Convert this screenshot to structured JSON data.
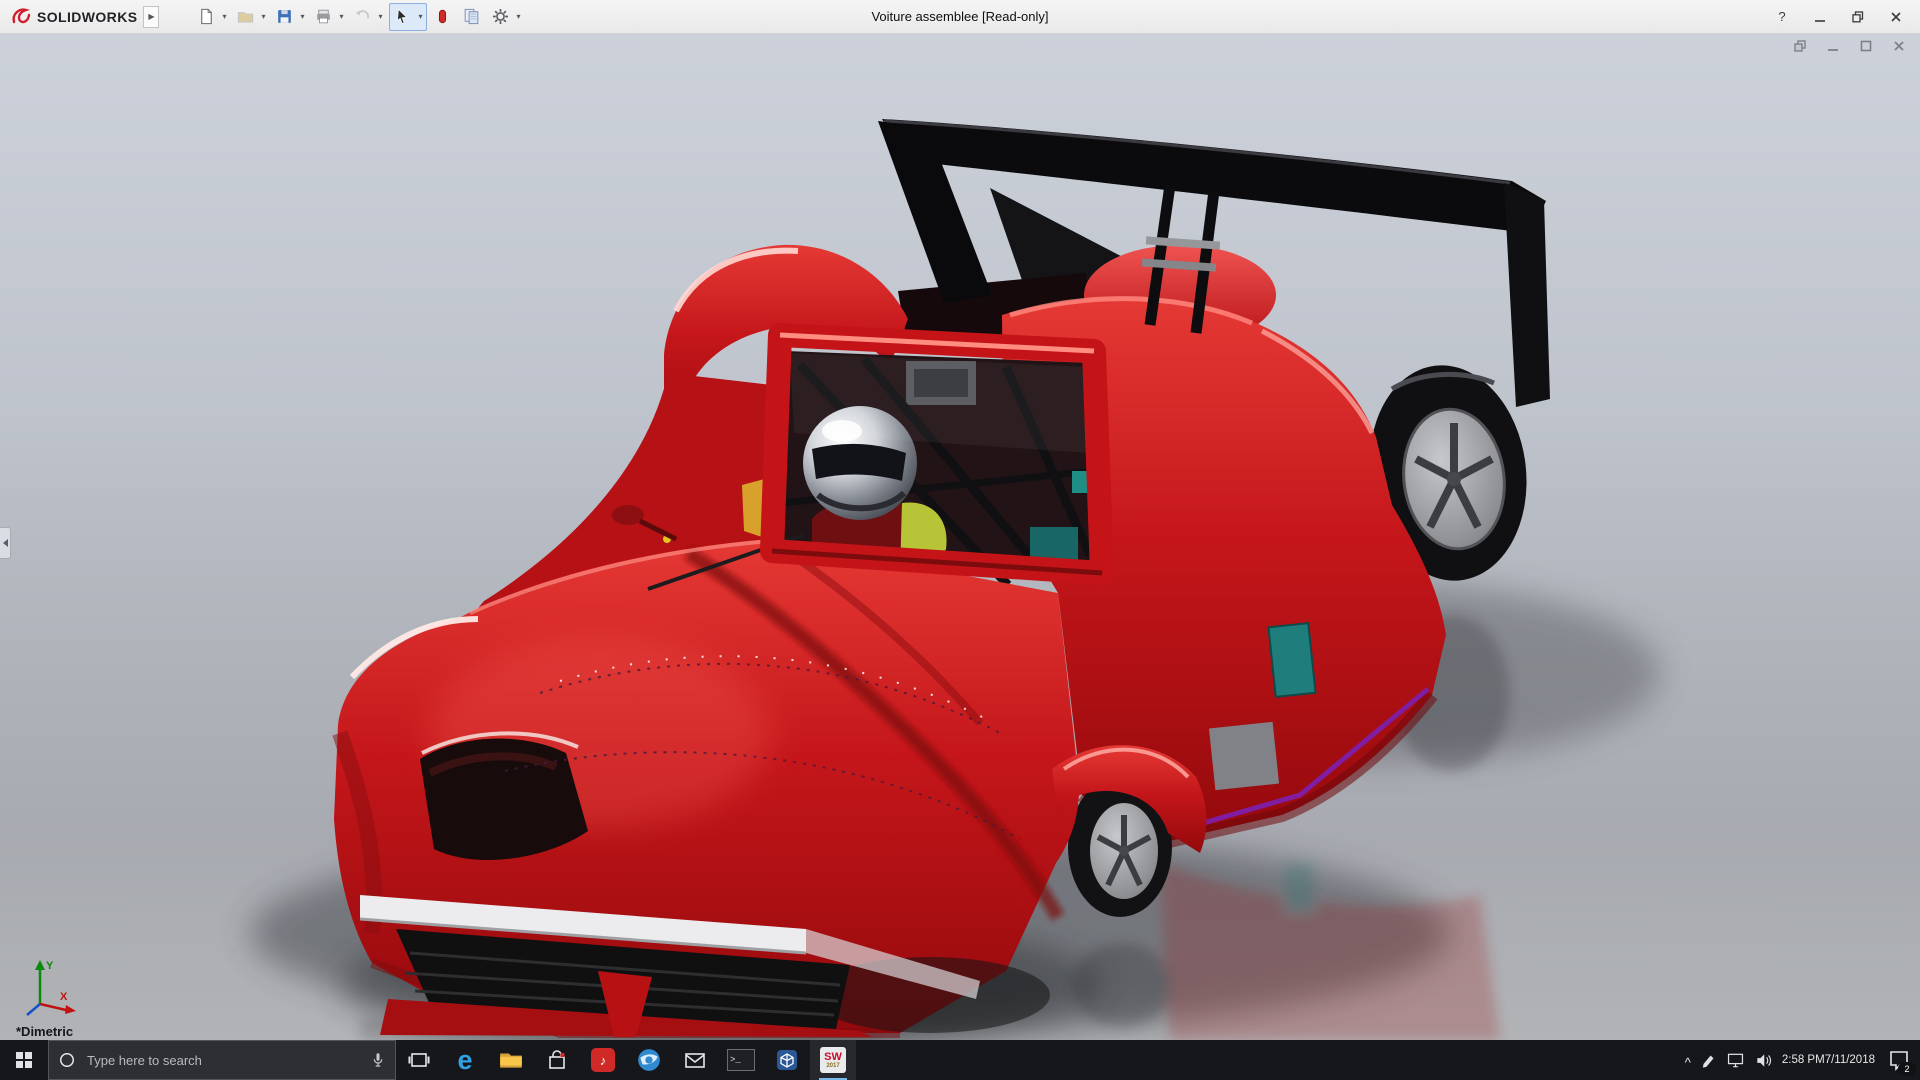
{
  "window": {
    "brand": "SOLIDWORKS",
    "title": "Voiture assemblee [Read-only]",
    "help_glyph": "?"
  },
  "toolbar": {
    "caret_glyph": "▾",
    "flyout_glyph": "▶",
    "buttons": [
      "new-document",
      "open",
      "save",
      "print",
      "undo",
      "select",
      "rebuild",
      "report",
      "options"
    ]
  },
  "viewport": {
    "orientation_label": "*Dimetric",
    "triad": {
      "x": "X",
      "y": "Y"
    },
    "controls": [
      "restore",
      "minimize",
      "maximize",
      "close"
    ]
  },
  "taskbar": {
    "search_placeholder": "Type here to search",
    "edge_letter": "e",
    "console_glyph": ">_",
    "red_app_glyph": "♪",
    "solidworks_text": "SW",
    "solidworks_year": "2017",
    "tray_expand_glyph": "^",
    "time": "2:58 PM",
    "date": "7/11/2018",
    "notification_count": "2"
  }
}
